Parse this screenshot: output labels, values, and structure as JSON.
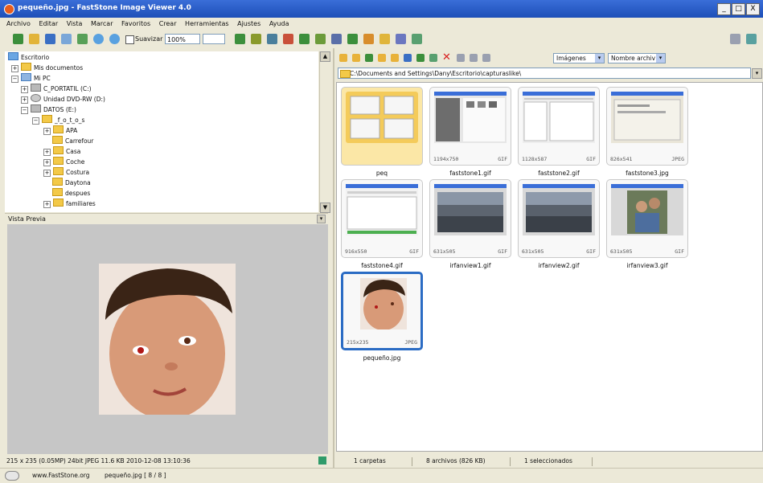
{
  "window": {
    "title": "pequeño.jpg - FastStone Image Viewer 4.0",
    "controls": [
      "_",
      "□",
      "X"
    ]
  },
  "menu": [
    "Archivo",
    "Editar",
    "Vista",
    "Marcar",
    "Favoritos",
    "Crear",
    "Herramientas",
    "Ajustes",
    "Ayuda"
  ],
  "toolbar": {
    "smooth_label": "Suavizar",
    "zoom_value": "100%"
  },
  "tree": {
    "items": [
      {
        "label": "Escritorio"
      },
      {
        "label": "Mis documentos"
      },
      {
        "label": "Mi PC"
      },
      {
        "label": "C_PORTATIL (C:)"
      },
      {
        "label": "Unidad DVD-RW (D:)"
      },
      {
        "label": "DATOS (E:)"
      },
      {
        "label": "_f_o_t_o_s"
      },
      {
        "label": "APA"
      },
      {
        "label": "Carrefour"
      },
      {
        "label": "Casa"
      },
      {
        "label": "Coche"
      },
      {
        "label": "Costura"
      },
      {
        "label": "Daytona"
      },
      {
        "label": "despues"
      },
      {
        "label": "familiares"
      }
    ]
  },
  "preview": {
    "title": "Vista Previa"
  },
  "left_status": {
    "info": "215 x 235 (0.05MP)  24bit JPEG  11.6 KB  2010-12-08 13:10:36"
  },
  "browser": {
    "filter": "Imágenes",
    "sort": "Nombre archiv",
    "path": "C:\\Documents and Settings\\Dany\\Escritorio\\capturaslike\\",
    "thumbs": [
      {
        "caption": "peq",
        "dims": "",
        "fmt": ""
      },
      {
        "caption": "faststone1.gif",
        "dims": "1194x750",
        "fmt": "GIF"
      },
      {
        "caption": "faststone2.gif",
        "dims": "1128x587",
        "fmt": "GIF"
      },
      {
        "caption": "faststone3.jpg",
        "dims": "826x541",
        "fmt": "JPEG"
      },
      {
        "caption": "faststone4.gif",
        "dims": "916x550",
        "fmt": "GIF"
      },
      {
        "caption": "irfanview1.gif",
        "dims": "631x505",
        "fmt": "GIF"
      },
      {
        "caption": "irfanview2.gif",
        "dims": "631x505",
        "fmt": "GIF"
      },
      {
        "caption": "irfanview3.gif",
        "dims": "631x505",
        "fmt": "GIF"
      },
      {
        "caption": "pequeño.jpg",
        "dims": "215x235",
        "fmt": "JPEG"
      }
    ]
  },
  "right_status": {
    "folders": "1 carpetas",
    "files": "8 archivos (826 KB)",
    "selected": "1 seleccionados"
  },
  "bottom": {
    "site": "www.FastStone.org",
    "file": "pequeño.jpg [ 8 / 8 ]"
  },
  "colors": {
    "titlebar": "#2256c6",
    "selection": "#2b6cc4",
    "folder": "#f3c948"
  }
}
